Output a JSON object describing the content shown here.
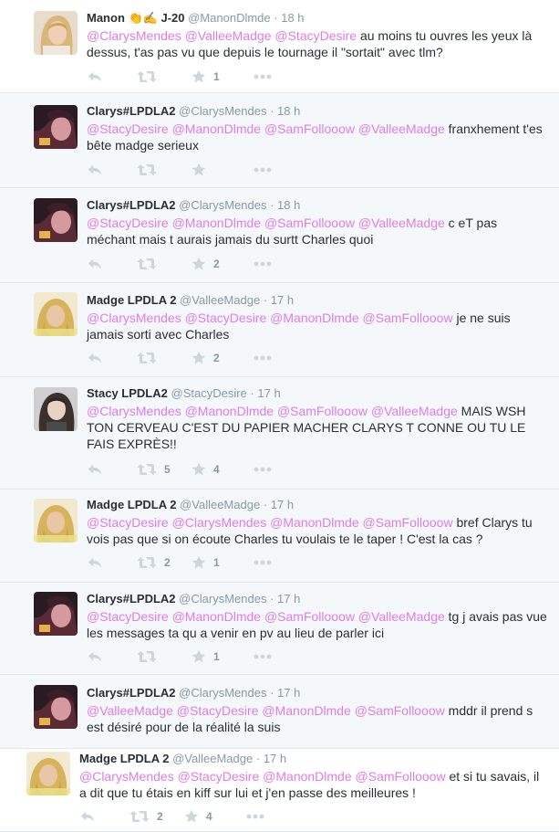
{
  "colors": {
    "mention": "#e07be6",
    "muted": "#8899a6",
    "icon": "#ccd6dd",
    "border": "#e1e8ed"
  },
  "tweets": [
    {
      "name": "Manon 👏✍ J-20",
      "handle": "@ManonDlmde",
      "sep": "·",
      "time": "18 h",
      "m1": "@ClarysMendes",
      "m2": "@ValleeMadge",
      "m3": "@StacyDesire",
      "m4": "",
      "text": "au moins tu ouvres les yeux là dessus, t'as pas vu que depuis le tournage il \"sortait\" avec tlm?",
      "retweets": "",
      "favorites": "1",
      "avatar": "blonde"
    },
    {
      "name": "Clarys#LPDLA2",
      "handle": "@ClarysMendes",
      "sep": "·",
      "time": "18 h",
      "m1": "@StacyDesire",
      "m2": "@ManonDlmde",
      "m3": "@SamFollooow",
      "m4": "@ValleeMadge",
      "text": "franxhement t'es bête madge serieux",
      "retweets": "",
      "favorites": "",
      "avatar": "clarys"
    },
    {
      "name": "Clarys#LPDLA2",
      "handle": "@ClarysMendes",
      "sep": "·",
      "time": "18 h",
      "m1": "@StacyDesire",
      "m2": "@ManonDlmde",
      "m3": "@SamFollooow",
      "m4": "@ValleeMadge",
      "text": "c eT pas méchant mais t aurais jamais du surtt Charles quoi",
      "retweets": "",
      "favorites": "2",
      "avatar": "clarys"
    },
    {
      "name": "Madge LPDLA 2",
      "handle": "@ValleeMadge",
      "sep": "·",
      "time": "17 h",
      "m1": "@ClarysMendes",
      "m2": "@StacyDesire",
      "m3": "@ManonDlmde",
      "m4": "@SamFollooow",
      "text": "je ne suis jamais sorti avec Charles",
      "retweets": "",
      "favorites": "2",
      "avatar": "madge"
    },
    {
      "name": "Stacy LPDLA2",
      "handle": "@StacyDesire",
      "sep": "·",
      "time": "17 h",
      "m1": "@ClarysMendes",
      "m2": "@ManonDlmde",
      "m3": "@SamFollooow",
      "m4": "@ValleeMadge",
      "text": "MAIS WSH TON CERVEAU C'EST DU PAPIER MACHER CLARYS T CONNE OU TU LE FAIS EXPRÈS!!",
      "retweets": "5",
      "favorites": "4",
      "avatar": "stacy"
    },
    {
      "name": "Madge LPDLA 2",
      "handle": "@ValleeMadge",
      "sep": "·",
      "time": "17 h",
      "m1": "@StacyDesire",
      "m2": "@ClarysMendes",
      "m3": "@ManonDlmde",
      "m4": "@SamFollooow",
      "text": "bref Clarys tu vois pas que si on écoute Charles tu voulais te le taper ! C'est la cas ?",
      "retweets": "2",
      "favorites": "1",
      "avatar": "madge"
    },
    {
      "name": "Clarys#LPDLA2",
      "handle": "@ClarysMendes",
      "sep": "·",
      "time": "17 h",
      "m1": "@StacyDesire",
      "m2": "@ManonDlmde",
      "m3": "@SamFollooow",
      "m4": "@ValleeMadge",
      "text": "tg j avais pas vue les messages ta qu a venir en pv au lieu de parler ici",
      "retweets": "",
      "favorites": "1",
      "avatar": "clarys"
    },
    {
      "name": "Clarys#LPDLA2",
      "handle": "@ClarysMendes",
      "sep": "·",
      "time": "17 h",
      "m1": "@ValleeMadge",
      "m2": "@StacyDesire",
      "m3": "@ManonDlmde",
      "m4": "@SamFollooow",
      "text": "mddr il prend s est désiré pour de la réalité la suis",
      "retweets": "",
      "favorites": "",
      "avatar": "clarys"
    },
    {
      "name": "Madge LPDLA 2",
      "handle": "@ValleeMadge",
      "sep": "·",
      "time": "17 h",
      "m1": "@ClarysMendes",
      "m2": "@StacyDesire",
      "m3": "@ManonDlmde",
      "m4": "@SamFollooow",
      "text": "et si tu savais, il a dit que tu étais en kiff sur lui et j'en passe des meilleures !",
      "retweets": "2",
      "favorites": "4",
      "avatar": "madge"
    }
  ]
}
